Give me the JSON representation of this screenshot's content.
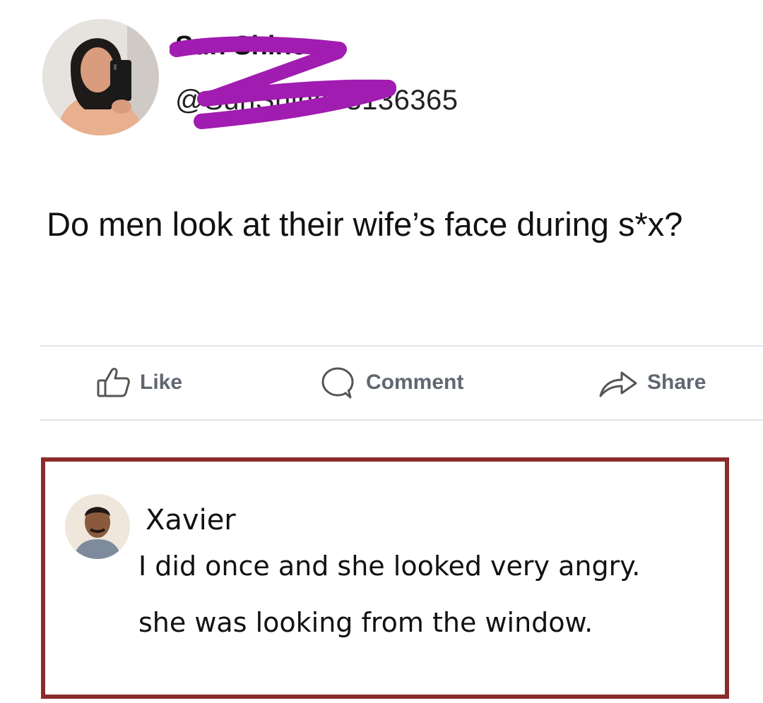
{
  "post": {
    "author_name": "Sun Shine",
    "author_handle": "@SunShine33136365",
    "text": "Do men look at their wife’s face during s*x?"
  },
  "actions": {
    "like_label": "Like",
    "comment_label": "Comment",
    "share_label": "Share"
  },
  "comment": {
    "author": "Xavier",
    "line1": "I did once and she looked very angry.",
    "line2": "she was looking from the window."
  },
  "colors": {
    "redaction": "#a11cb0",
    "highlight_border": "#8b2b2b",
    "action_text": "#606770",
    "divider": "#e4e6eb"
  }
}
